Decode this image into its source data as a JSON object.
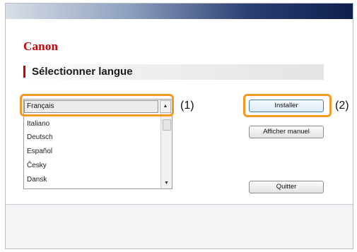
{
  "brand": {
    "logo": "Canon"
  },
  "page": {
    "heading": "Sélectionner langue"
  },
  "language_list": {
    "selected": "Français",
    "items": [
      "Italiano",
      "Deutsch",
      "Español",
      "Česky",
      "Dansk"
    ]
  },
  "buttons": {
    "install": "Installer",
    "manual": "Afficher manuel",
    "quit": "Quitter"
  },
  "callouts": {
    "one": "(1)",
    "two": "(2)"
  },
  "colors": {
    "highlight": "#f39a24",
    "brand_red": "#cc0000"
  },
  "icons": {
    "up": "▲",
    "down": "▼"
  }
}
